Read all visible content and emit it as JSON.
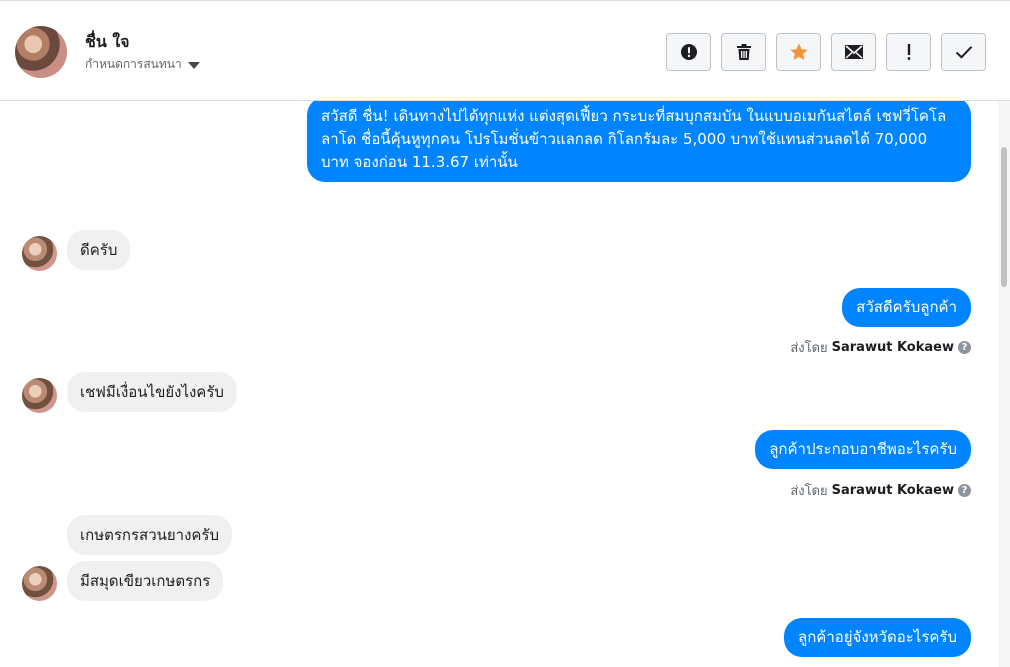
{
  "header": {
    "contact_name": "ชื่น ใจ",
    "conversation_settings_label": "กำหนดการสนทนา",
    "actions": [
      {
        "name": "report-button",
        "icon": "alert-circle-icon"
      },
      {
        "name": "delete-button",
        "icon": "trash-icon"
      },
      {
        "name": "star-button",
        "icon": "star-icon",
        "color": "#f7923b"
      },
      {
        "name": "mark-unread-button",
        "icon": "envelope-icon"
      },
      {
        "name": "important-button",
        "icon": "exclamation-icon"
      },
      {
        "name": "mark-done-button",
        "icon": "check-icon"
      }
    ]
  },
  "colors": {
    "outgoing_bubble": "#0084ff",
    "incoming_bubble": "#f1f0f0",
    "star": "#f7923b"
  },
  "messages": [
    {
      "direction": "out",
      "text": "สวัสดี ชื่น! เดินทางไปได้ทุกแห่ง แต่งสุดเฟี้ยว กระบะที่สมบุกสมบัน ในแบบอเมกันสไตล์ เชฟวี่โคโลลาโด ชื่อนี้คุ้นหูทุกคน โปรโมชั่นข้าวแลกลด กิโลกรัมละ 5,000 บาทใช้แทนส่วนลดได้ 70,000 บาท จองก่อน 11.3.67 เท่านั้น"
    },
    {
      "direction": "in",
      "text": "ดีครับ"
    },
    {
      "direction": "out",
      "text": "สวัสดีครับลูกค้า"
    },
    {
      "direction": "in",
      "text": "เชฟมีเงื่อนไขยังไงครับ"
    },
    {
      "direction": "out",
      "text": "ลูกค้าประกอบอาชีพอะไรครับ"
    },
    {
      "direction": "in",
      "text": "เกษตรกรสวนยางครับ"
    },
    {
      "direction": "in",
      "text": "มีสมุดเขียวเกษตรกร"
    },
    {
      "direction": "out",
      "text": "ลูกค้าอยู่จังหวัดอะไรครับ"
    }
  ],
  "sent_by": {
    "prefix": "ส่งโดย",
    "name": "Sarawut Kokaew",
    "help_icon": "?"
  }
}
